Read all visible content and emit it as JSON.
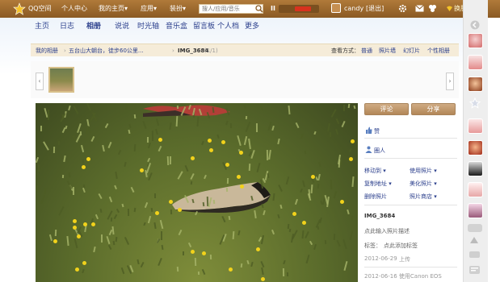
{
  "topbar": {
    "brand": "QQ空间",
    "personal_center": "个人中心",
    "my_home": "我的主页",
    "my_home_arrow": "▾",
    "apps": "应用",
    "apps_arrow": "▾",
    "decorate": "装扮",
    "decorate_arrow": "▾",
    "search_placeholder": "搜人/应用/音乐",
    "pause": "II",
    "username": "candy",
    "logout": "[退出]",
    "skin": "换肤"
  },
  "nav": {
    "items": [
      "主页",
      "日志",
      "相册",
      "说说",
      "时光轴",
      "音乐盒",
      "留言板",
      "个人档",
      "更多"
    ]
  },
  "crumb": {
    "album_root": "我的相册",
    "sep1": "›",
    "album": "五台山大朝台，徒步60公里...",
    "sep2": "›",
    "photo": "IMG_3684",
    "pos": "(1/1)",
    "view_label": "查看方式：",
    "views": [
      "普通",
      "照片墙",
      "幻灯片",
      "个性相册"
    ]
  },
  "strip": {
    "prev": "‹",
    "next": "›"
  },
  "side": {
    "comment": "评论",
    "share": "分享",
    "like": "赞",
    "circle": "圈人",
    "move": "移动到 ▾",
    "use": "使用照片 ▾",
    "copy": "复制地址 ▾",
    "beautify": "美化照片 ▾",
    "delete": "删除照片",
    "shop": "照片商店 ▾",
    "title": "IMG_3684",
    "desc_prompt": "点此输入照片描述",
    "tag_label": "标签：",
    "tag_prompt": "点此添加标签",
    "upload_date": "2012-06-29",
    "upload_text": "上传",
    "shot_info": "2012-06-16 使用Canon EOS"
  },
  "colors": {
    "accent": "#a8783f",
    "link": "#2b3f8c",
    "grass": "#6b7a33"
  }
}
